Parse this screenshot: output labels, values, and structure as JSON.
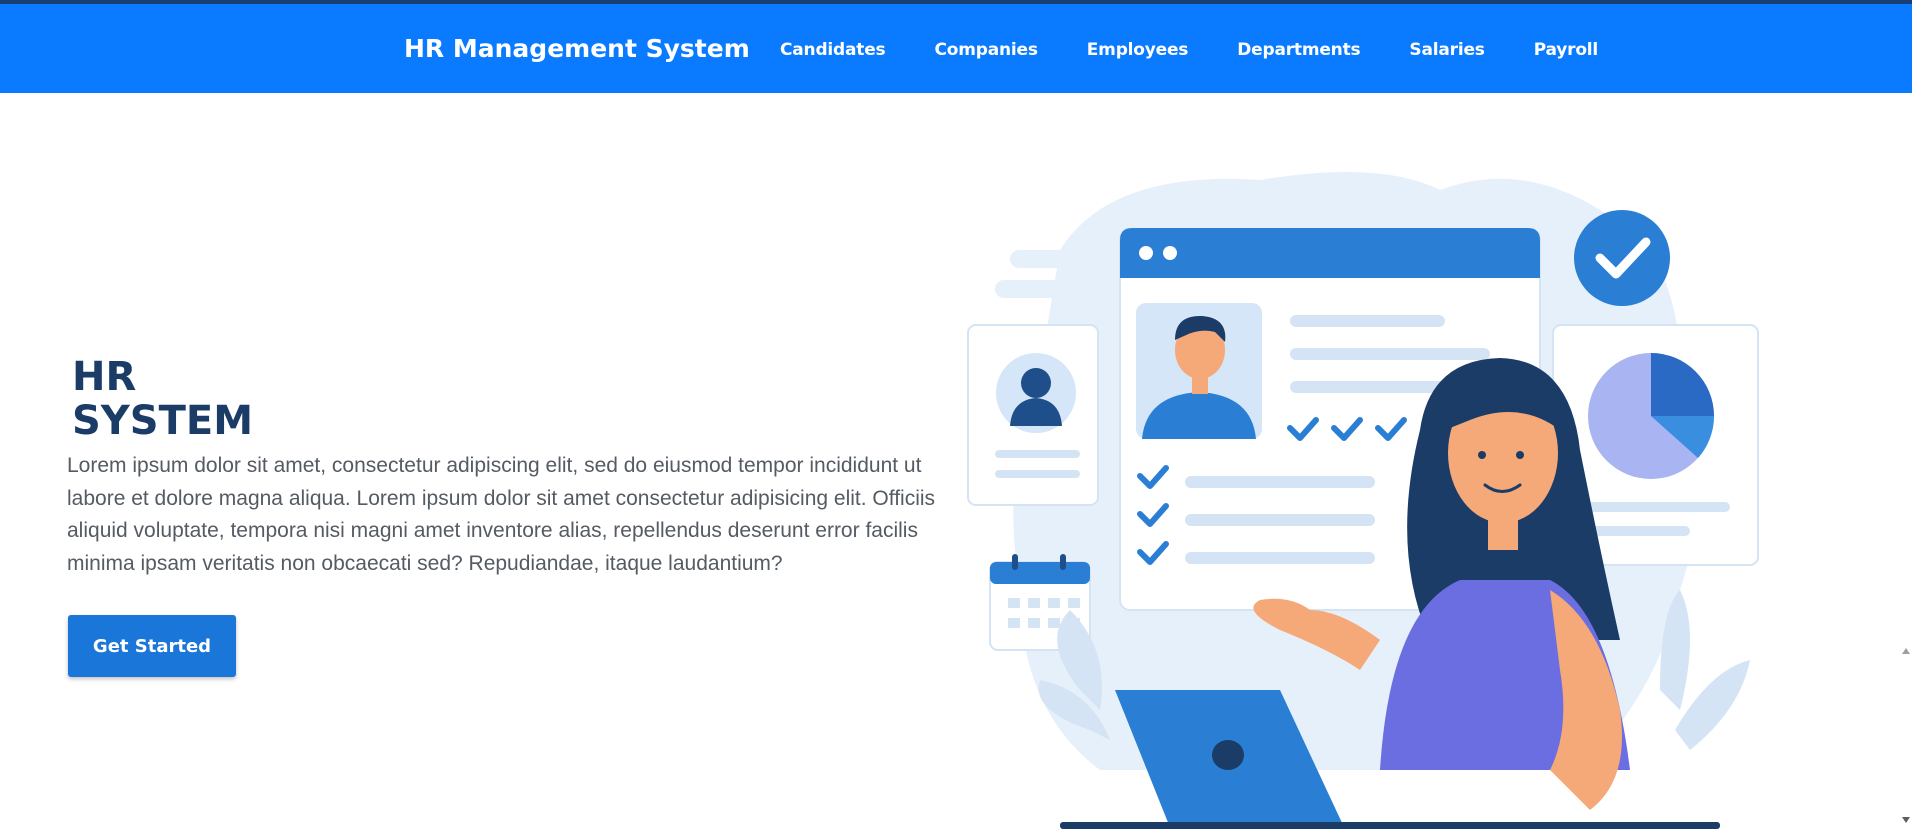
{
  "colors": {
    "navbar": "#0a7bff",
    "title": "#1a3c66",
    "button": "#1a76d8",
    "illustration_primary": "#2a7fd4",
    "illustration_light": "#e3eef9"
  },
  "navbar": {
    "brand": "HR Management System",
    "links": [
      "Candidates",
      "Companies",
      "Employees",
      "Departments",
      "Salaries",
      "Payroll"
    ]
  },
  "hero": {
    "title_line1": "HR",
    "title_line2": "SYSTEM",
    "description": "Lorem ipsum dolor sit amet, consectetur adipiscing elit, sed do eiusmod tempor incididunt ut labore et dolore magna aliqua. Lorem ipsum dolor sit amet consectetur adipisicing elit. Officiis aliquid voluptate, tempora nisi magni amet inventore alias, repellendus deserunt error facilis minima ipsam veritatis non obcaecati sed? Repudiandae, itaque laudantium?",
    "cta_label": "Get Started"
  },
  "illustration": {
    "icon": "hr-illustration-icon"
  }
}
